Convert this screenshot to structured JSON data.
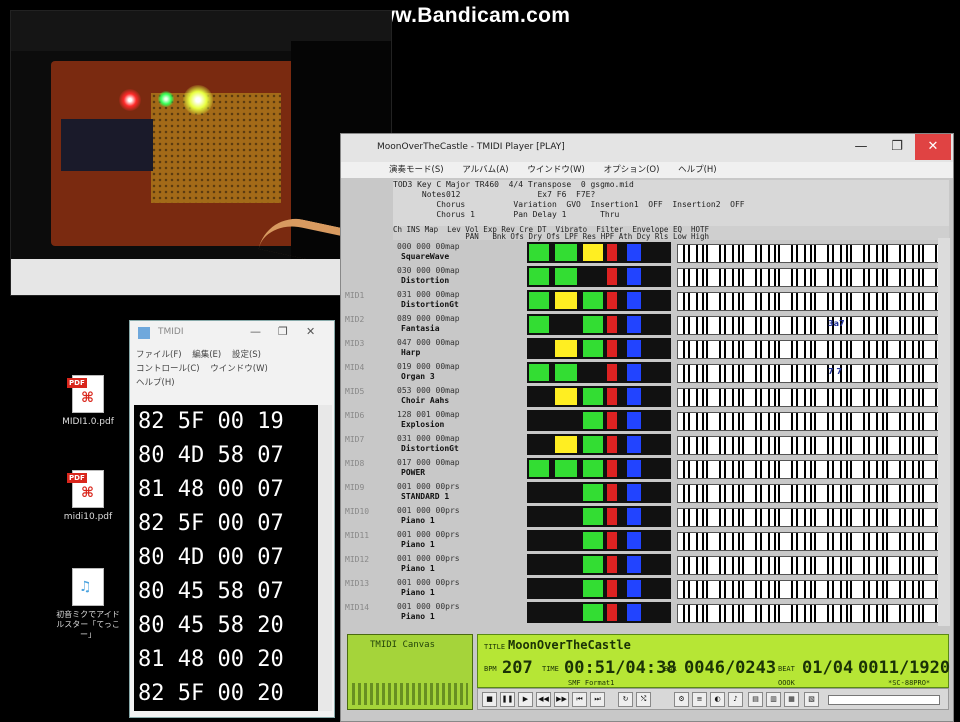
{
  "watermark": {
    "text": "www.Bandicam.com"
  },
  "desktop_icons": [
    {
      "label": "MIDI1.0.pdf",
      "type": "pdf"
    },
    {
      "label": "midi10.pdf",
      "type": "pdf"
    },
    {
      "label": "初音ミクでアイドルスター「てっこー」",
      "type": "audio"
    }
  ],
  "hex_window": {
    "title": "TMIDI",
    "menu": [
      "ファイル(F)",
      "編集(E)",
      "設定(S)",
      "コントロール(C)",
      "ウインドウ(W)",
      "ヘルプ(H)"
    ],
    "rows": [
      "82 5F 00 19",
      "80 4D 58 07",
      "81 48 00 07",
      "82 5F 00 07",
      "80 4D 00 07",
      "80 45 58 07",
      "80 45 58 20",
      "81 48 00 20",
      "82 5F 00 20"
    ]
  },
  "tmidi": {
    "title": "MoonOverTheCastle - TMIDI Player [PLAY]",
    "menu": [
      "演奏モード(S)",
      "アルバム(A)",
      "ウインドウ(W)",
      "オプション(O)",
      "ヘルプ(H)"
    ],
    "info_rows": [
      "TOD3 Key C Major TR460  4/4 Transpose  0 gsgmo.mid",
      "      Notes012                Ex7 F6  F7E?",
      "         Chorus          Variation  GVO  Insertion1  OFF  Insertion2  OFF",
      "         Chorus 1        Pan Delay 1       Thru"
    ],
    "header": "Ch INS Map  Lev Vol Exp Rev Cre DT  Vibrato  Filter  Envelope EQ  HOTF\n                PAN   Bnk Ofs Dry Ofs LPF Res HPF Ath Dcy Rls Low High",
    "channels": [
      {
        "num": "",
        "l1": "000 000 00map",
        "l2": "SquareWave"
      },
      {
        "num": "",
        "l1": "030 000 00map",
        "l2": "Distortion"
      },
      {
        "num": "MID1",
        "l1": "031 000 00map",
        "l2": "DistortionGt"
      },
      {
        "num": "MID2",
        "l1": "089 000 00map",
        "l2": "Fantasia",
        "mark": "3a7"
      },
      {
        "num": "MID3",
        "l1": "047 000 00map",
        "l2": "Harp"
      },
      {
        "num": "MID4",
        "l1": "019 000 00map",
        "l2": "Organ 3",
        "mark": "7 7"
      },
      {
        "num": "MID5",
        "l1": "053 000 00map",
        "l2": "Choir Aahs"
      },
      {
        "num": "MID6",
        "l1": "128 001 00map",
        "l2": "Explosion"
      },
      {
        "num": "MID7",
        "l1": "031 000 00map",
        "l2": "DistortionGt"
      },
      {
        "num": "MID8",
        "l1": "017 000 00map",
        "l2": "POWER"
      },
      {
        "num": "MID9",
        "l1": "001 000 00prs",
        "l2": "STANDARD 1"
      },
      {
        "num": "MID10",
        "l1": "001 000 00prs",
        "l2": "Piano 1"
      },
      {
        "num": "MID11",
        "l1": "001 000 00prs",
        "l2": "Piano 1"
      },
      {
        "num": "MID12",
        "l1": "001 000 00prs",
        "l2": "Piano 1"
      },
      {
        "num": "MID13",
        "l1": "001 000 00prs",
        "l2": "Piano 1"
      },
      {
        "num": "MID14",
        "l1": "001 000 00prs",
        "l2": "Piano 1"
      }
    ],
    "canvas_label": "TMIDI Canvas",
    "lcd": {
      "title_label": "TITLE",
      "title": "MoonOverTheCastle",
      "bpm_label": "BPM",
      "bpm": "207",
      "time_label": "TIME",
      "time": "00:51/04:38",
      "bar_label": "BAR",
      "bar": "0046/0243",
      "beat_label": "BEAT",
      "beat": "01/04",
      "tick": "0011/1920",
      "format": "SMF Format1",
      "module": "*SC-88PRO*",
      "status": "OOOK"
    },
    "window_buttons": [
      "—",
      "❐",
      "✕"
    ]
  }
}
